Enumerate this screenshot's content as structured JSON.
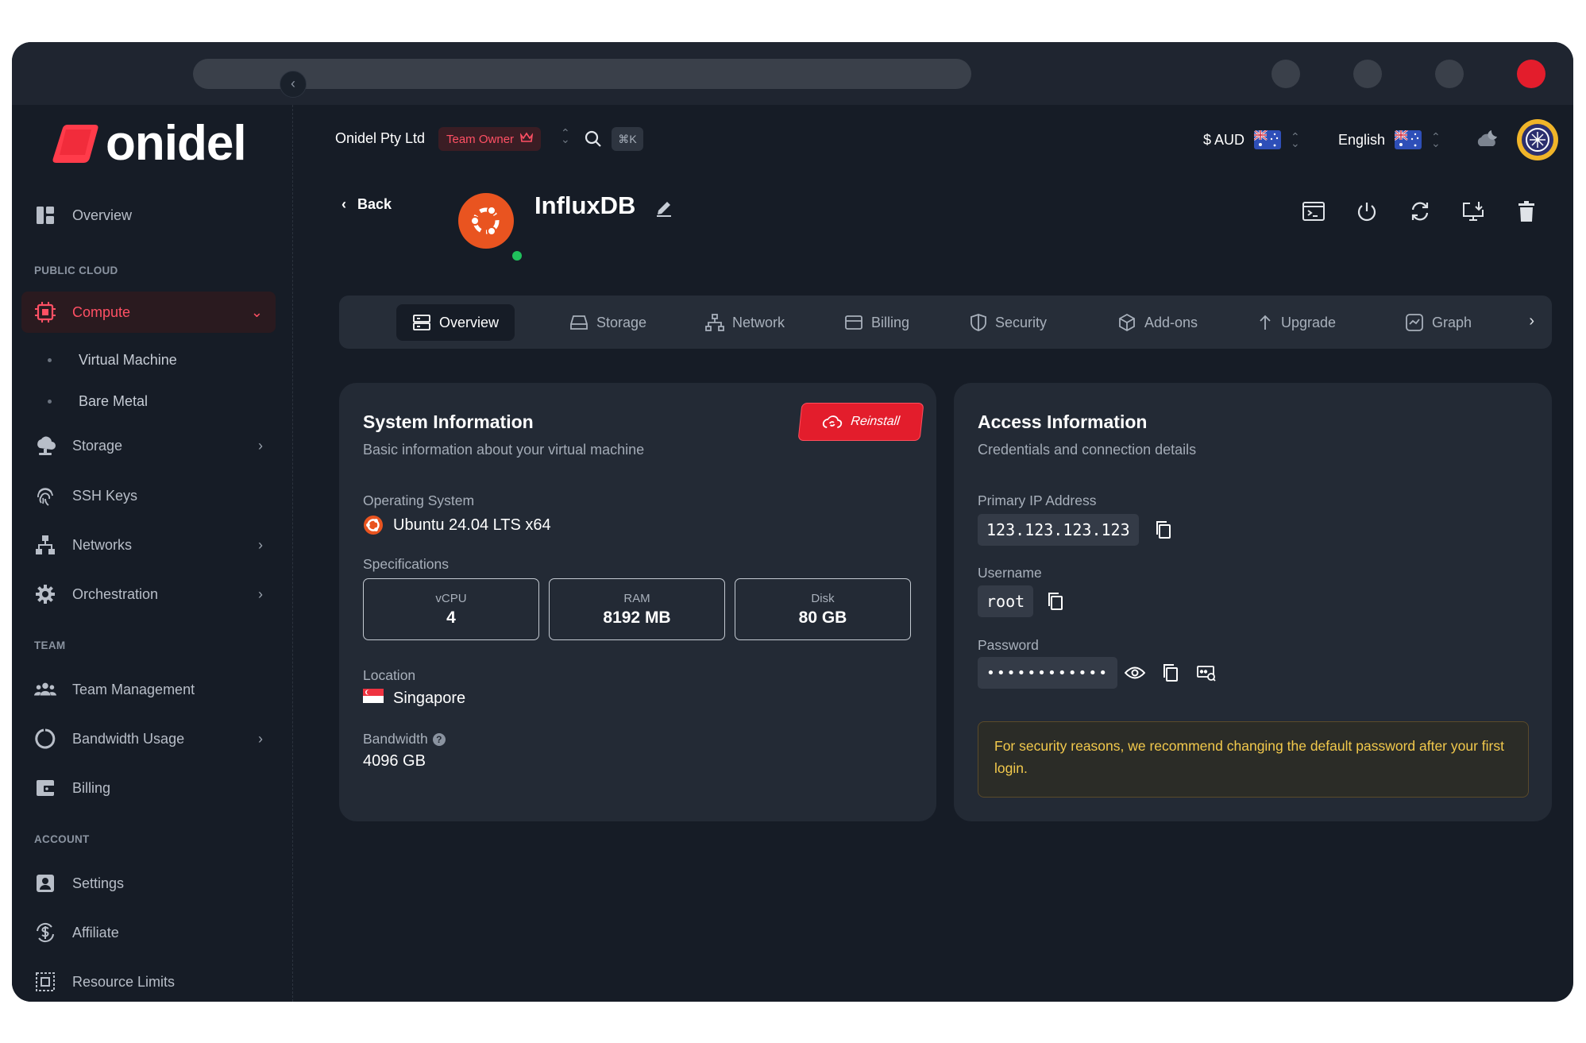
{
  "brand": {
    "name": "onidel"
  },
  "topbar": {
    "company": "Onidel Pty Ltd",
    "role_badge": "Team Owner",
    "shortcut": "⌘K",
    "currency": "$ AUD",
    "language": "English"
  },
  "sidebar": {
    "overview": "Overview",
    "section_public_cloud": "PUBLIC CLOUD",
    "compute": "Compute",
    "virtual_machine": "Virtual Machine",
    "bare_metal": "Bare Metal",
    "storage": "Storage",
    "ssh_keys": "SSH Keys",
    "networks": "Networks",
    "orchestration": "Orchestration",
    "section_team": "TEAM",
    "team_management": "Team Management",
    "bandwidth_usage": "Bandwidth Usage",
    "billing": "Billing",
    "section_account": "ACCOUNT",
    "settings": "Settings",
    "affiliate": "Affiliate",
    "resource_limits": "Resource Limits"
  },
  "header": {
    "back": "Back",
    "title": "InfluxDB"
  },
  "tabs": [
    {
      "label": "Overview"
    },
    {
      "label": "Storage"
    },
    {
      "label": "Network"
    },
    {
      "label": "Billing"
    },
    {
      "label": "Security"
    },
    {
      "label": "Add-ons"
    },
    {
      "label": "Upgrade"
    },
    {
      "label": "Graph"
    }
  ],
  "system": {
    "title": "System Information",
    "subtitle": "Basic information about your virtual machine",
    "reinstall": "Reinstall",
    "os_label": "Operating System",
    "os_value": "Ubuntu 24.04 LTS x64",
    "specs_label": "Specifications",
    "specs": [
      {
        "key": "vCPU",
        "value": "4"
      },
      {
        "key": "RAM",
        "value": "8192 MB"
      },
      {
        "key": "Disk",
        "value": "80 GB"
      }
    ],
    "location_label": "Location",
    "location_value": "Singapore",
    "bandwidth_label": "Bandwidth",
    "bandwidth_value": "4096 GB"
  },
  "access": {
    "title": "Access Information",
    "subtitle": "Credentials and connection details",
    "ip_label": "Primary IP Address",
    "ip_value": "123.123.123.123",
    "username_label": "Username",
    "username_value": "root",
    "password_label": "Password",
    "password_value": "••••••••••••",
    "warning": "For security reasons, we recommend changing the default password after your first login."
  },
  "colors": {
    "accent": "#e31d2c",
    "background": "#161c26",
    "card": "#232a35",
    "online": "#20c05c",
    "warning_text": "#f2c94c"
  }
}
